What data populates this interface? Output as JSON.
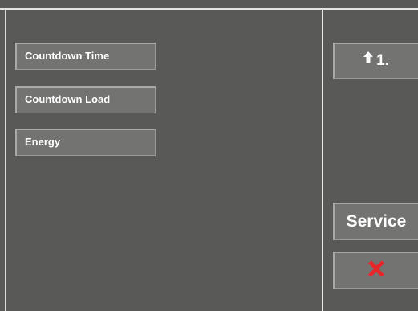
{
  "menu": {
    "items": [
      {
        "label": "Countdown Time"
      },
      {
        "label": "Countdown Load"
      },
      {
        "label": "Energy"
      }
    ]
  },
  "side": {
    "up_button": {
      "label": "1.",
      "icon": "up-arrow-icon"
    },
    "service_button": {
      "label": "Service"
    },
    "cancel_button": {
      "icon": "close-icon"
    }
  },
  "colors": {
    "background": "#595957",
    "button_face": "#737371",
    "button_highlight": "#a9a9a7",
    "text": "#ffffff",
    "cancel_icon": "#e8262a"
  }
}
